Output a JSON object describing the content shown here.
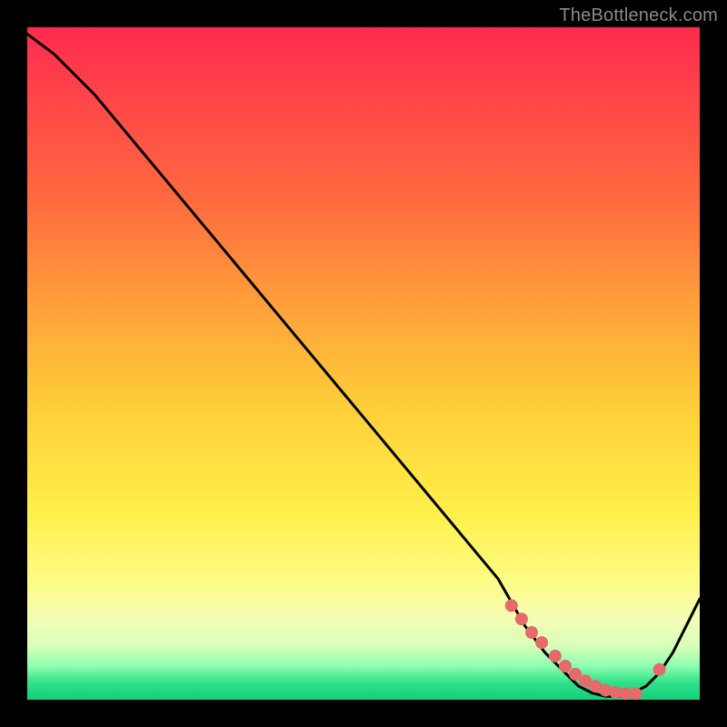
{
  "attribution": "TheBottleneck.com",
  "colors": {
    "black": "#000000",
    "curve": "#000000",
    "dot": "#e76a6a",
    "attribution_text": "#8a8a8a",
    "gradient_top": "#ff2a4f",
    "gradient_mid": "#ffe54a",
    "gradient_bottom": "#14cf7b"
  },
  "chart_data": {
    "type": "line",
    "title": "",
    "xlabel": "",
    "ylabel": "",
    "xlim": [
      0,
      100
    ],
    "ylim": [
      0,
      100
    ],
    "grid": false,
    "legend": false,
    "series": [
      {
        "name": "bottleneck-curve",
        "x": [
          0,
          4,
          10,
          20,
          30,
          40,
          50,
          60,
          70,
          74,
          77,
          80,
          82,
          84,
          86,
          88,
          90,
          92,
          94,
          96,
          100
        ],
        "y": [
          99,
          96,
          90,
          78,
          66,
          54,
          42,
          30,
          18,
          11,
          7,
          4,
          2,
          1,
          0.5,
          0.5,
          1,
          2,
          4,
          7,
          15
        ]
      }
    ],
    "highlight_points": {
      "name": "optimal-range-dots",
      "x": [
        72,
        73.5,
        75,
        76.5,
        78.5,
        80,
        81.5,
        83,
        84.5,
        86,
        87.5,
        89,
        90.5,
        94
      ],
      "y": [
        14,
        12,
        10,
        8.5,
        6.5,
        5,
        3.8,
        2.8,
        2,
        1.4,
        1.1,
        0.9,
        0.9,
        4.5
      ]
    },
    "notes": "Axes are unlabeled; x appears to be a component metric (e.g. GPU/CPU score) and y a bottleneck percentage. Green band at bottom (~0–5) is optimal; red at top is severe bottleneck. Dots mark the near-zero valley."
  }
}
